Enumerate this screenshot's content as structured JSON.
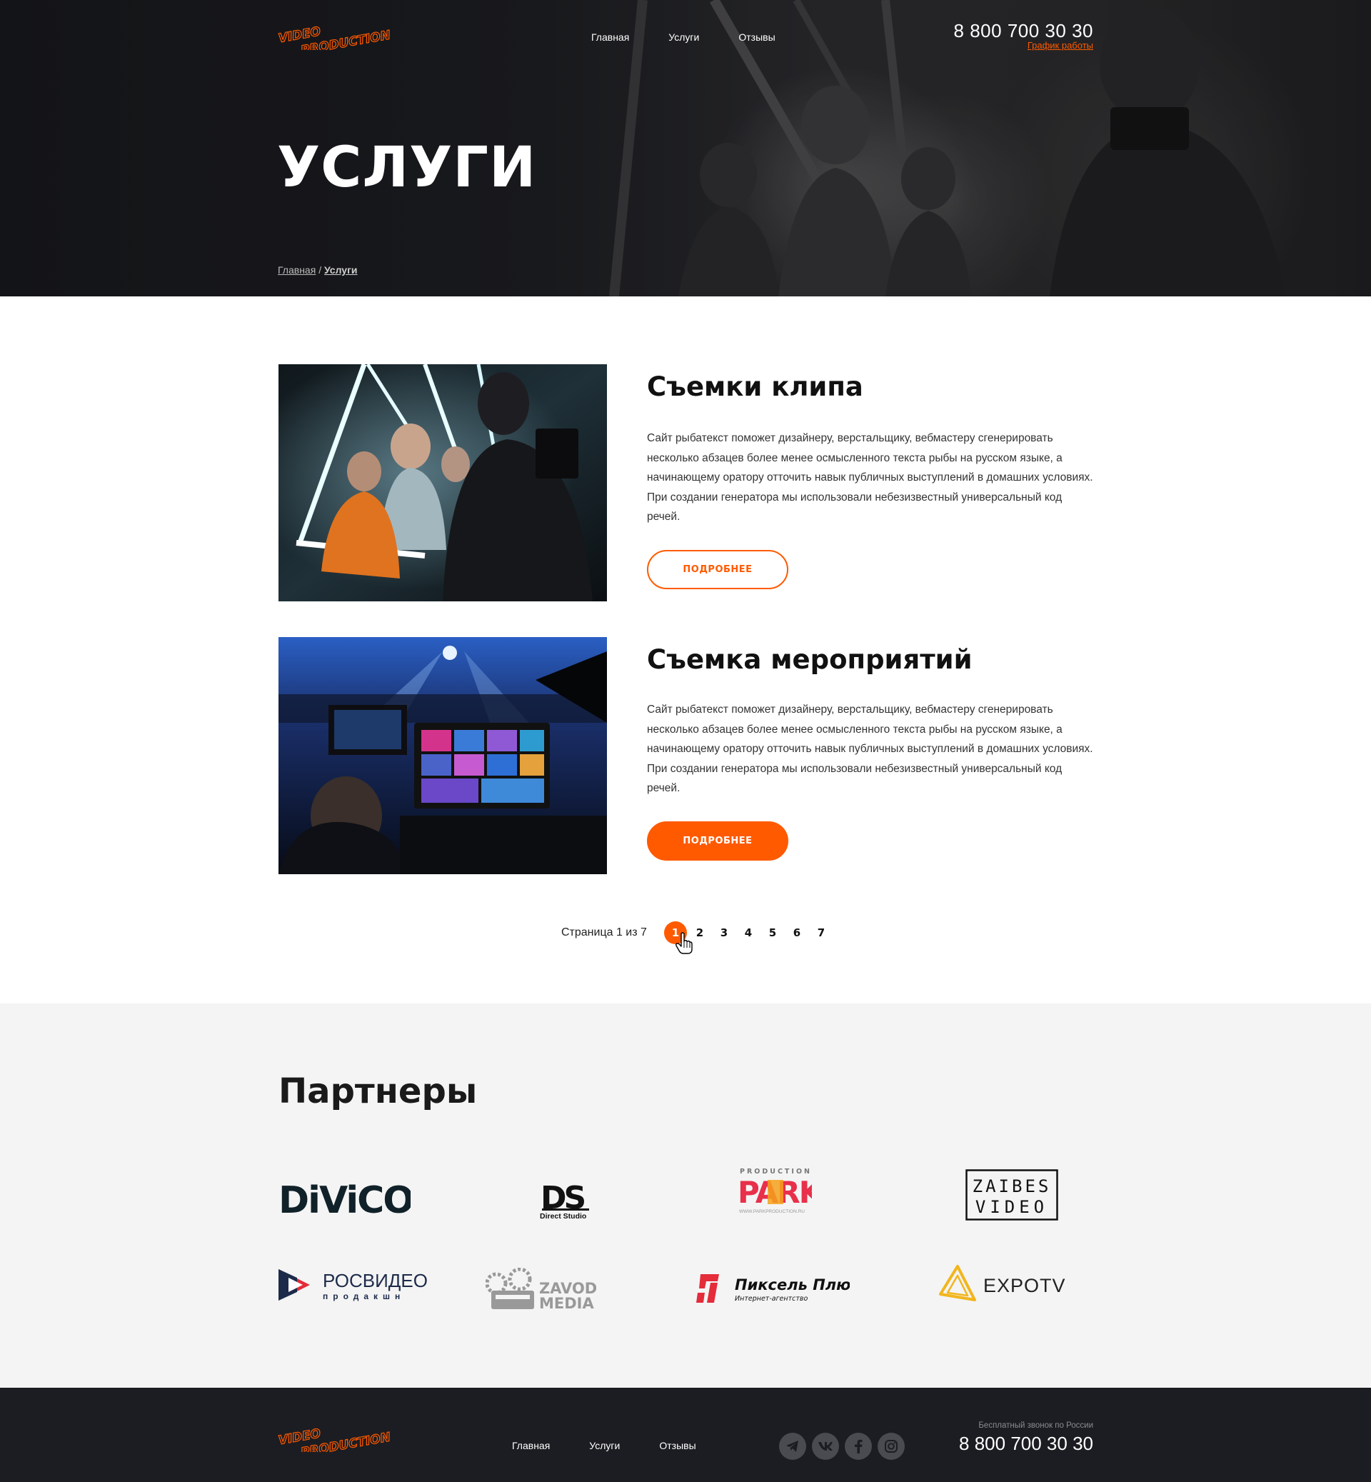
{
  "brand": {
    "line1": "VIDEO",
    "line2": "PRODUCTION",
    "accent": "#ff5a00"
  },
  "nav": {
    "home": "Главная",
    "services": "Услуги",
    "reviews": "Отзывы"
  },
  "header": {
    "phone": "8 800 700 30 30",
    "schedule_link": "График работы"
  },
  "hero": {
    "title": "УСЛУГИ"
  },
  "breadcrumb": {
    "home": "Главная",
    "separator": "/",
    "current": "Услуги"
  },
  "services": [
    {
      "title": "Съемки клипа",
      "description": "Сайт рыбатекст поможет дизайнеру, верстальщику, вебмастеру сгенерировать несколько абзацев более менее осмысленного текста рыбы на русском языке, а начинающему оратору отточить навык публичных выступлений в домашних условиях. При создании генератора мы использовали небезизвестный универсальный код речей.",
      "button": "ПОДРОБНЕЕ",
      "button_style": "outline"
    },
    {
      "title": "Съемка мероприятий",
      "description": "Сайт рыбатекст поможет дизайнеру, верстальщику, вебмастеру сгенерировать несколько абзацев более менее осмысленного текста рыбы на русском языке, а начинающему оратору отточить навык публичных выступлений в домашних условиях. При создании генератора мы использовали небезизвестный универсальный код речей.",
      "button": "ПОДРОБНЕЕ",
      "button_style": "filled"
    }
  ],
  "pagination": {
    "label": "Страница 1 из 7",
    "pages": [
      "1",
      "2",
      "3",
      "4",
      "5",
      "6",
      "7"
    ],
    "current": "1"
  },
  "partners": {
    "title": "Партнеры",
    "logos": [
      {
        "name": "DIVICO",
        "text": "DiViCO"
      },
      {
        "name": "Direct Studio",
        "text": "DS",
        "sub": "Direct Studio"
      },
      {
        "name": "Production Park",
        "text": "PARK",
        "top": "PRODUCTION",
        "sub": "WWW.PARKPRODUCTION.RU"
      },
      {
        "name": "Zaibes Video",
        "text1": "ZAIBES",
        "text2": "VIDEO"
      },
      {
        "name": "Росвидео продакшн",
        "text": "РОСВИДЕО",
        "sub": "продакшн"
      },
      {
        "name": "Zavod Media",
        "text1": "ZAVOD",
        "text2": "MEDIA"
      },
      {
        "name": "Пиксель Плюс",
        "text": "Пиксель Плюс",
        "sub": "Интернет-агентство"
      },
      {
        "name": "EXPOTV",
        "text": "EXPOTV"
      }
    ]
  },
  "footer": {
    "caption": "Бесплатный звонок по России",
    "phone": "8 800 700 30 30",
    "socials": [
      "telegram-icon",
      "vk-icon",
      "facebook-icon",
      "instagram-icon"
    ]
  }
}
